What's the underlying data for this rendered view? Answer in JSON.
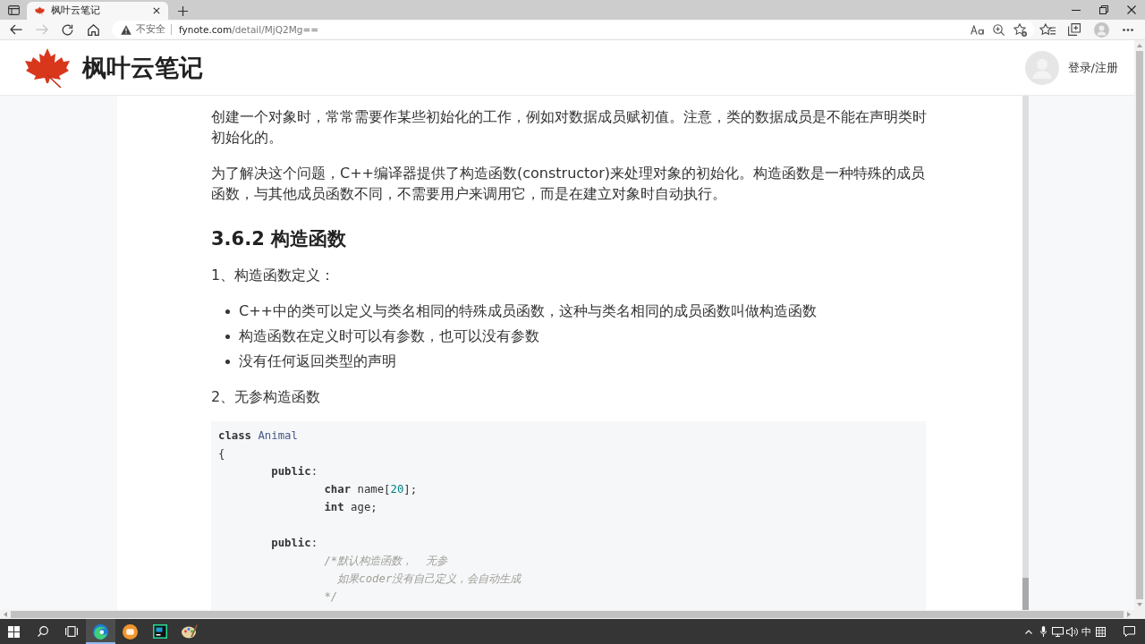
{
  "browser": {
    "tabs": [
      {
        "title": "枫叶云笔记",
        "selected": true
      }
    ],
    "nav_buttons": [
      {
        "kind": "back",
        "disabled": false
      },
      {
        "kind": "forward",
        "disabled": true
      },
      {
        "kind": "refresh",
        "disabled": false
      },
      {
        "kind": "home",
        "disabled": false
      }
    ],
    "address_bar": {
      "security_label": "不安全",
      "host": "fynote.com",
      "path": "/detail/MjQ2Mg=="
    },
    "toolbar_buttons": [
      {
        "kind": "read_aloud"
      },
      {
        "kind": "zoom"
      },
      {
        "kind": "add_favorite"
      },
      {
        "kind": "favorites"
      },
      {
        "kind": "collections"
      },
      {
        "kind": "profile"
      },
      {
        "kind": "more"
      }
    ]
  },
  "site_header": {
    "brand": "枫叶云笔记",
    "login_link": "登录/注册"
  },
  "article": {
    "blocks": [
      {
        "kind": "paragraph",
        "text": "创建一个对象时，常常需要作某些初始化的工作，例如对数据成员赋初值。注意，类的数据成员是不能在声明类时初始化的。"
      },
      {
        "kind": "paragraph",
        "text": "为了解决这个问题，C++编译器提供了构造函数(constructor)来处理对象的初始化。构造函数是一种特殊的成员函数，与其他成员函数不同，不需要用户来调用它，而是在建立对象时自动执行。"
      },
      {
        "kind": "heading",
        "text": "3.6.2 构造函数"
      },
      {
        "kind": "label",
        "text": "1、构造函数定义："
      },
      {
        "kind": "bullets",
        "items": [
          "C++中的类可以定义与类名相同的特殊成员函数，这种与类名相同的成员函数叫做构造函数",
          "构造函数在定义时可以有参数，也可以没有参数",
          "没有任何返回类型的声明"
        ]
      },
      {
        "kind": "label",
        "text": "2、无参构造函数"
      },
      {
        "kind": "code",
        "lines": [
          {
            "kind": "code",
            "tokens": [
              {
                "text": "class ",
                "kind": "keyword"
              },
              {
                "text": "Animal",
                "kind": "class_name"
              }
            ]
          },
          {
            "kind": "code",
            "tokens": [
              {
                "text": "{",
                "kind": "plain"
              }
            ]
          },
          {
            "kind": "code",
            "tokens": [
              {
                "text": "        public",
                "kind": "keyword"
              },
              {
                "text": ":",
                "kind": "plain"
              }
            ]
          },
          {
            "kind": "code",
            "tokens": [
              {
                "text": "                char",
                "kind": "keyword"
              },
              {
                "text": " name[",
                "kind": "plain"
              },
              {
                "text": "20",
                "kind": "number"
              },
              {
                "text": "];",
                "kind": "plain"
              }
            ]
          },
          {
            "kind": "code",
            "tokens": [
              {
                "text": "                int",
                "kind": "keyword"
              },
              {
                "text": " age;",
                "kind": "plain"
              }
            ]
          },
          {
            "kind": "blank"
          },
          {
            "kind": "code",
            "tokens": [
              {
                "text": "        public",
                "kind": "keyword"
              },
              {
                "text": ":",
                "kind": "plain"
              }
            ]
          },
          {
            "kind": "code",
            "tokens": [
              {
                "text": "                /*默认构造函数，  无参",
                "kind": "comment"
              }
            ]
          },
          {
            "kind": "code",
            "tokens": [
              {
                "text": "                  如果coder没有自己定义，会自动生成",
                "kind": "comment"
              }
            ]
          },
          {
            "kind": "code",
            "tokens": [
              {
                "text": "                */",
                "kind": "comment"
              }
            ]
          }
        ]
      }
    ]
  },
  "taskbar": {
    "apps": [
      {
        "kind": "browser",
        "selected": true
      },
      {
        "kind": "round_app",
        "selected": false
      },
      {
        "kind": "square_app",
        "selected": false
      },
      {
        "kind": "paint",
        "selected": false
      }
    ],
    "input_method": "中"
  }
}
